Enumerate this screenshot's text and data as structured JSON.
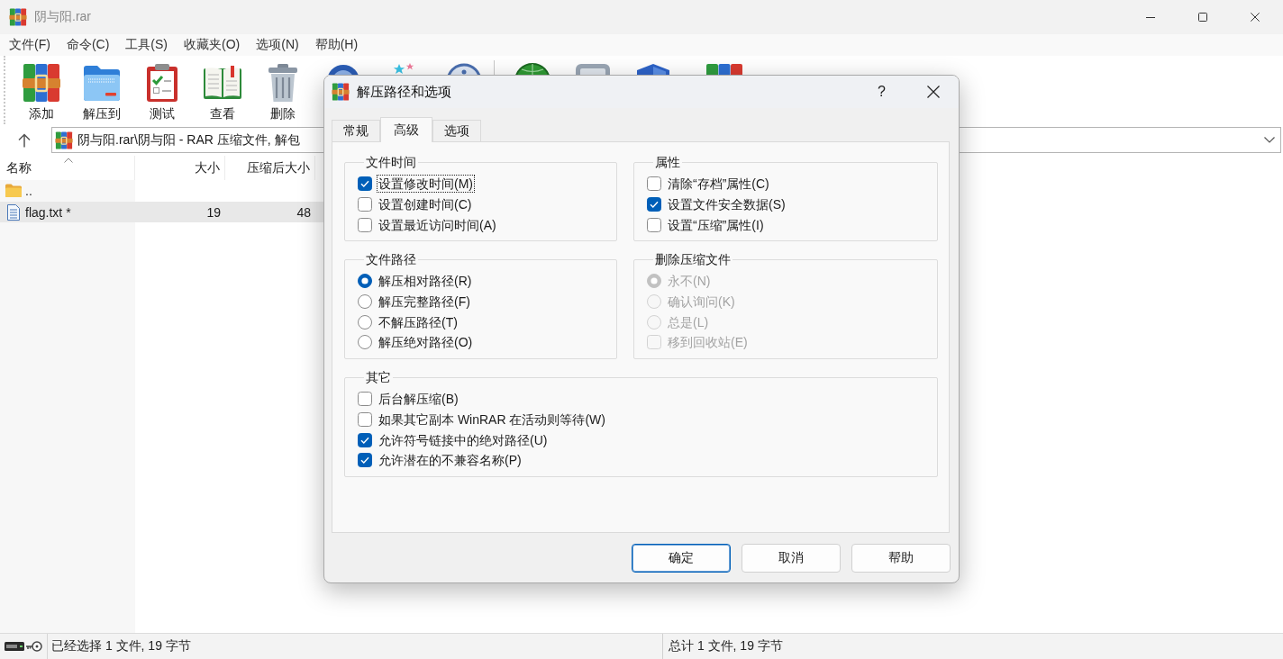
{
  "window": {
    "title": "阴与阳.rar"
  },
  "menu": [
    "文件(F)",
    "命令(C)",
    "工具(S)",
    "收藏夹(O)",
    "选项(N)",
    "帮助(H)"
  ],
  "toolbar": [
    "添加",
    "解压到",
    "测试",
    "查看",
    "删除"
  ],
  "address_bar": {
    "path": "阴与阳.rar\\阴与阳 - RAR 压缩文件, 解包"
  },
  "file_list": {
    "columns": [
      {
        "label": "名称",
        "sorted": true
      },
      {
        "label": "大小",
        "sorted": false
      },
      {
        "label": "压缩后大小",
        "sorted": false
      }
    ],
    "rows": [
      {
        "kind": "folder",
        "name": "..",
        "selected": false
      },
      {
        "kind": "file",
        "name": "flag.txt *",
        "size": "19",
        "packed": "48",
        "selected": true
      }
    ]
  },
  "status_bar": {
    "selection": "已经选择 1 文件, 19 字节",
    "total": "总计 1 文件, 19 字节"
  },
  "dialog": {
    "title": "解压路径和选项",
    "help_button": "?",
    "tabs": [
      {
        "label": "常规",
        "selected": false
      },
      {
        "label": "高级",
        "selected": true
      },
      {
        "label": "选项",
        "selected": false
      }
    ],
    "groups": [
      {
        "title": "文件时间",
        "items": [
          {
            "kind": "checkbox",
            "label": "设置修改时间(M)",
            "checked": true,
            "disabled": false,
            "focused": true
          },
          {
            "kind": "checkbox",
            "label": "设置创建时间(C)",
            "checked": false,
            "disabled": false,
            "focused": false
          },
          {
            "kind": "checkbox",
            "label": "设置最近访问时间(A)",
            "checked": false,
            "disabled": false,
            "focused": false
          }
        ]
      },
      {
        "title": "属性",
        "items": [
          {
            "kind": "checkbox",
            "label": "清除“存档”属性(C)",
            "checked": false,
            "disabled": false,
            "focused": false
          },
          {
            "kind": "checkbox",
            "label": "设置文件安全数据(S)",
            "checked": true,
            "disabled": false,
            "focused": false
          },
          {
            "kind": "checkbox",
            "label": "设置“压缩”属性(I)",
            "checked": false,
            "disabled": false,
            "focused": false
          }
        ]
      },
      {
        "title": "文件路径",
        "items": [
          {
            "kind": "radio",
            "label": "解压相对路径(R)",
            "selected": true,
            "disabled": false,
            "focused": false
          },
          {
            "kind": "radio",
            "label": "解压完整路径(F)",
            "selected": false,
            "disabled": false,
            "focused": false
          },
          {
            "kind": "radio",
            "label": "不解压路径(T)",
            "selected": false,
            "disabled": false,
            "focused": false
          },
          {
            "kind": "radio",
            "label": "解压绝对路径(O)",
            "selected": false,
            "disabled": false,
            "focused": false
          }
        ]
      },
      {
        "title": "删除压缩文件",
        "items": [
          {
            "kind": "radio",
            "label": "永不(N)",
            "selected": true,
            "disabled": true,
            "focused": false
          },
          {
            "kind": "radio",
            "label": "确认询问(K)",
            "selected": false,
            "disabled": true,
            "focused": false
          },
          {
            "kind": "radio",
            "label": "总是(L)",
            "selected": false,
            "disabled": true,
            "focused": false
          },
          {
            "kind": "checkbox",
            "label": "移到回收站(E)",
            "checked": false,
            "disabled": true,
            "focused": false
          }
        ]
      },
      {
        "title": "其它",
        "items": [
          {
            "kind": "checkbox",
            "label": "后台解压缩(B)",
            "checked": false,
            "disabled": false,
            "focused": false
          },
          {
            "kind": "checkbox",
            "label": "如果其它副本 WinRAR 在活动则等待(W)",
            "checked": false,
            "disabled": false,
            "focused": false
          },
          {
            "kind": "checkbox",
            "label": "允许符号链接中的绝对路径(U)",
            "checked": true,
            "disabled": false,
            "focused": false
          },
          {
            "kind": "checkbox",
            "label": "允许潜在的不兼容名称(P)",
            "checked": true,
            "disabled": false,
            "focused": false
          }
        ]
      }
    ],
    "buttons": [
      {
        "label": "确定",
        "default": true
      },
      {
        "label": "取消",
        "default": false
      },
      {
        "label": "帮助",
        "default": false
      }
    ]
  }
}
